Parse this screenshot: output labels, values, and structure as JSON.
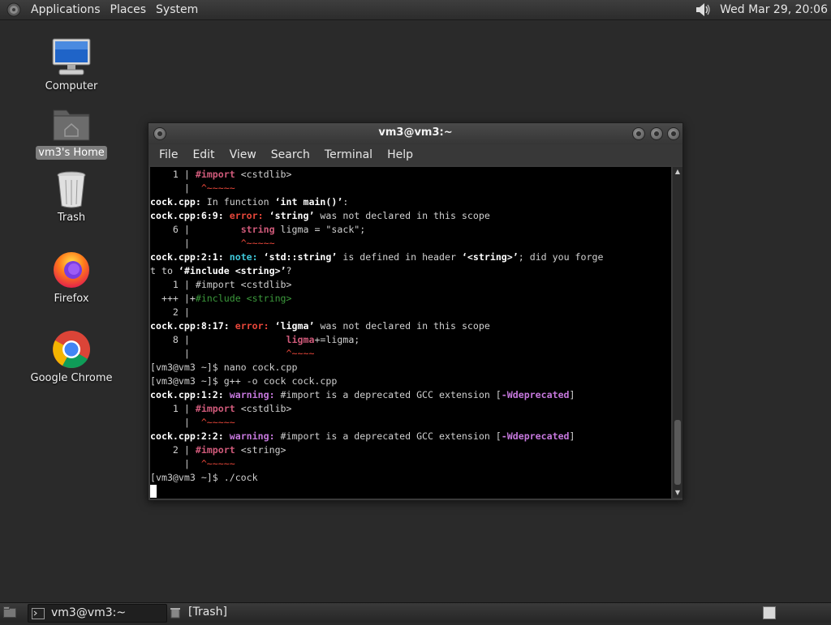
{
  "top_panel": {
    "menus": [
      "Applications",
      "Places",
      "System"
    ],
    "clock": "Wed Mar 29, 20:06",
    "icons": {
      "logo": "gnome-foot-icon",
      "volume": "speaker-icon"
    }
  },
  "desktop": {
    "icons": [
      {
        "label": "Computer",
        "icon": "computer-icon"
      },
      {
        "label": "vm3's Home",
        "icon": "home-folder-icon",
        "selected": true
      },
      {
        "label": "Trash",
        "icon": "trash-icon"
      },
      {
        "label": "Firefox",
        "icon": "firefox-icon"
      },
      {
        "label": "Google Chrome",
        "icon": "chrome-icon"
      }
    ]
  },
  "terminal": {
    "title": "vm3@vm3:~",
    "menu": [
      "File",
      "Edit",
      "View",
      "Search",
      "Terminal",
      "Help"
    ],
    "lines": [
      [
        {
          "t": "    1 | "
        },
        {
          "t": "#import",
          "c": "kw"
        },
        {
          "t": " <cstdlib>"
        }
      ],
      [
        {
          "t": "      |  "
        },
        {
          "t": "^~~~~~",
          "c": "red"
        }
      ],
      [
        {
          "t": "cock.cpp:",
          "c": "b"
        },
        {
          "t": " In function "
        },
        {
          "t": "‘int main()’",
          "c": "b"
        },
        {
          "t": ":"
        }
      ],
      [
        {
          "t": "cock.cpp:6:9:",
          "c": "b"
        },
        {
          "t": " "
        },
        {
          "t": "error:",
          "c": "err"
        },
        {
          "t": " "
        },
        {
          "t": "‘string’",
          "c": "b"
        },
        {
          "t": " was not declared in this scope"
        }
      ],
      [
        {
          "t": "    6 |         "
        },
        {
          "t": "string",
          "c": "kw"
        },
        {
          "t": " ligma = \"sack\";"
        }
      ],
      [
        {
          "t": "      |         "
        },
        {
          "t": "^~~~~~",
          "c": "red"
        }
      ],
      [
        {
          "t": "cock.cpp:2:1:",
          "c": "b"
        },
        {
          "t": " "
        },
        {
          "t": "note:",
          "c": "note"
        },
        {
          "t": " "
        },
        {
          "t": "‘std::string’",
          "c": "b"
        },
        {
          "t": " is defined in header "
        },
        {
          "t": "‘<string>’",
          "c": "b"
        },
        {
          "t": "; did you forge"
        }
      ],
      [
        {
          "t": "t to "
        },
        {
          "t": "‘#include <string>’",
          "c": "b"
        },
        {
          "t": "?"
        }
      ],
      [
        {
          "t": "    1 | #import <cstdlib>"
        }
      ],
      [
        {
          "t": "  +++ |+"
        },
        {
          "t": "#include <string>",
          "c": "grn"
        }
      ],
      [
        {
          "t": "    2 |"
        }
      ],
      [
        {
          "t": "cock.cpp:8:17:",
          "c": "b"
        },
        {
          "t": " "
        },
        {
          "t": "error:",
          "c": "err"
        },
        {
          "t": " "
        },
        {
          "t": "‘ligma’",
          "c": "b"
        },
        {
          "t": " was not declared in this scope"
        }
      ],
      [
        {
          "t": "    8 |                 "
        },
        {
          "t": "ligma",
          "c": "kw"
        },
        {
          "t": "+=ligma;"
        }
      ],
      [
        {
          "t": "      |                 "
        },
        {
          "t": "^~~~~",
          "c": "red"
        }
      ],
      [
        {
          "t": "[vm3@vm3 ~]$ nano cock.cpp"
        }
      ],
      [
        {
          "t": "[vm3@vm3 ~]$ g++ -o cock cock.cpp"
        }
      ],
      [
        {
          "t": "cock.cpp:1:2:",
          "c": "b"
        },
        {
          "t": " "
        },
        {
          "t": "warning:",
          "c": "warn"
        },
        {
          "t": " #import is a deprecated GCC extension ["
        },
        {
          "t": "-Wdeprecated",
          "c": "warn"
        },
        {
          "t": "]"
        }
      ],
      [
        {
          "t": "    1 | "
        },
        {
          "t": "#import",
          "c": "kw"
        },
        {
          "t": " <cstdlib>"
        }
      ],
      [
        {
          "t": "      |  "
        },
        {
          "t": "^~~~~~",
          "c": "red"
        }
      ],
      [
        {
          "t": "cock.cpp:2:2:",
          "c": "b"
        },
        {
          "t": " "
        },
        {
          "t": "warning:",
          "c": "warn"
        },
        {
          "t": " #import is a deprecated GCC extension ["
        },
        {
          "t": "-Wdeprecated",
          "c": "warn"
        },
        {
          "t": "]"
        }
      ],
      [
        {
          "t": "    2 | "
        },
        {
          "t": "#import",
          "c": "kw"
        },
        {
          "t": " <string>"
        }
      ],
      [
        {
          "t": "      |  "
        },
        {
          "t": "^~~~~~",
          "c": "red"
        }
      ],
      [
        {
          "t": "[vm3@vm3 ~]$ ./cock"
        }
      ]
    ]
  },
  "bottom_panel": {
    "tasks": [
      {
        "label": "vm3@vm3:~",
        "icon": "terminal-icon",
        "active": true
      },
      {
        "label": "[Trash]",
        "icon": "trash-icon",
        "active": false
      }
    ]
  }
}
